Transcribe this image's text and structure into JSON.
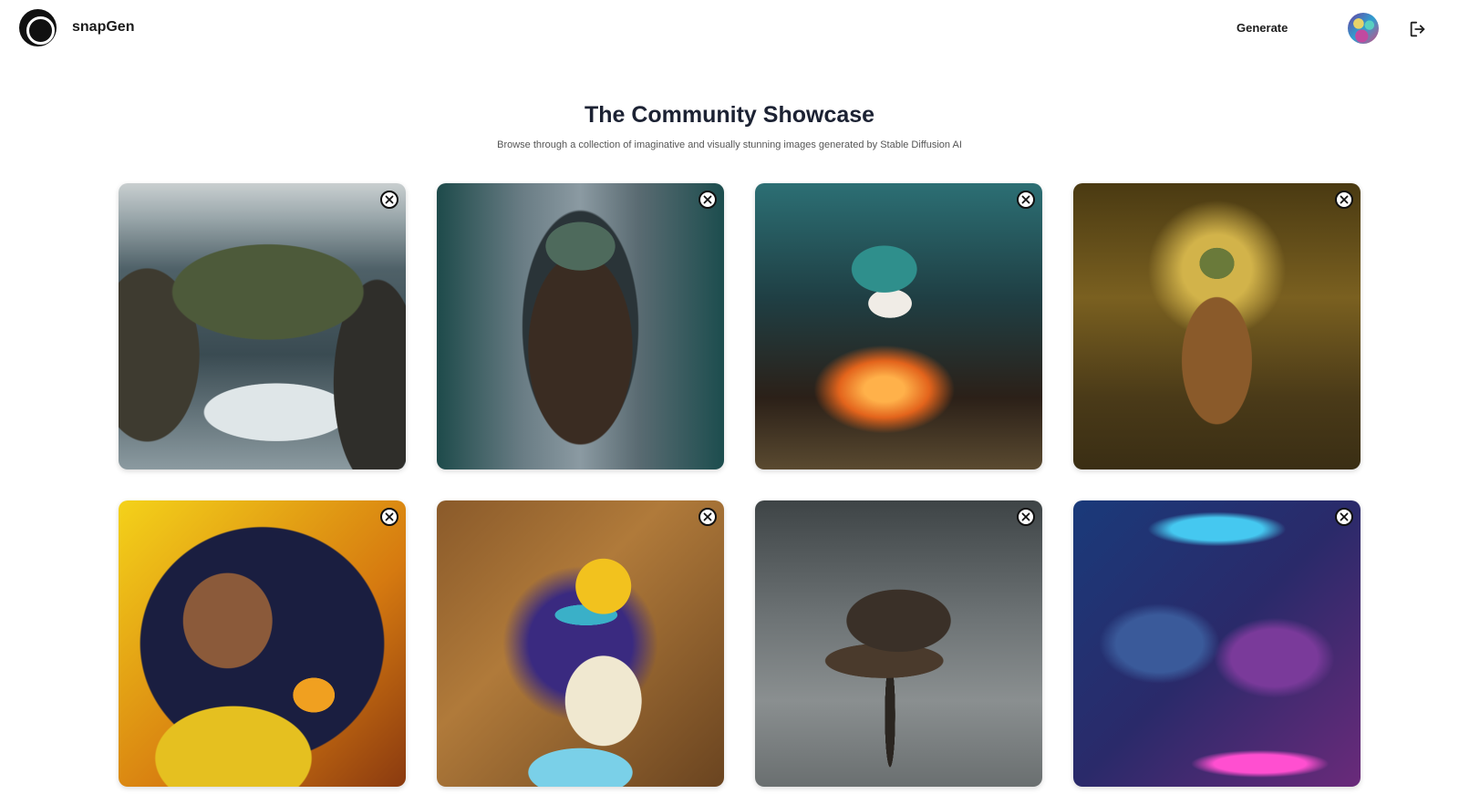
{
  "header": {
    "brand": "snapGen",
    "nav_generate": "Generate",
    "logo_icon": "aperture-logo-icon",
    "avatar_icon": "user-avatar",
    "logout_icon": "logout-icon"
  },
  "showcase": {
    "title": "The Community Showcase",
    "subtitle": "Browse through a collection of imaginative and visually stunning images generated by Stable Diffusion AI"
  },
  "gallery": {
    "items": [
      {
        "art": "sea-cliff-castle"
      },
      {
        "art": "tentacle-faced-wanderer"
      },
      {
        "art": "underwater-creature"
      },
      {
        "art": "forest-witch"
      },
      {
        "art": "musician-with-duck"
      },
      {
        "art": "ornate-rubber-duck"
      },
      {
        "art": "floating-treehouse"
      },
      {
        "art": "neon-crowd"
      }
    ],
    "delete_icon": "close-circle-icon"
  }
}
